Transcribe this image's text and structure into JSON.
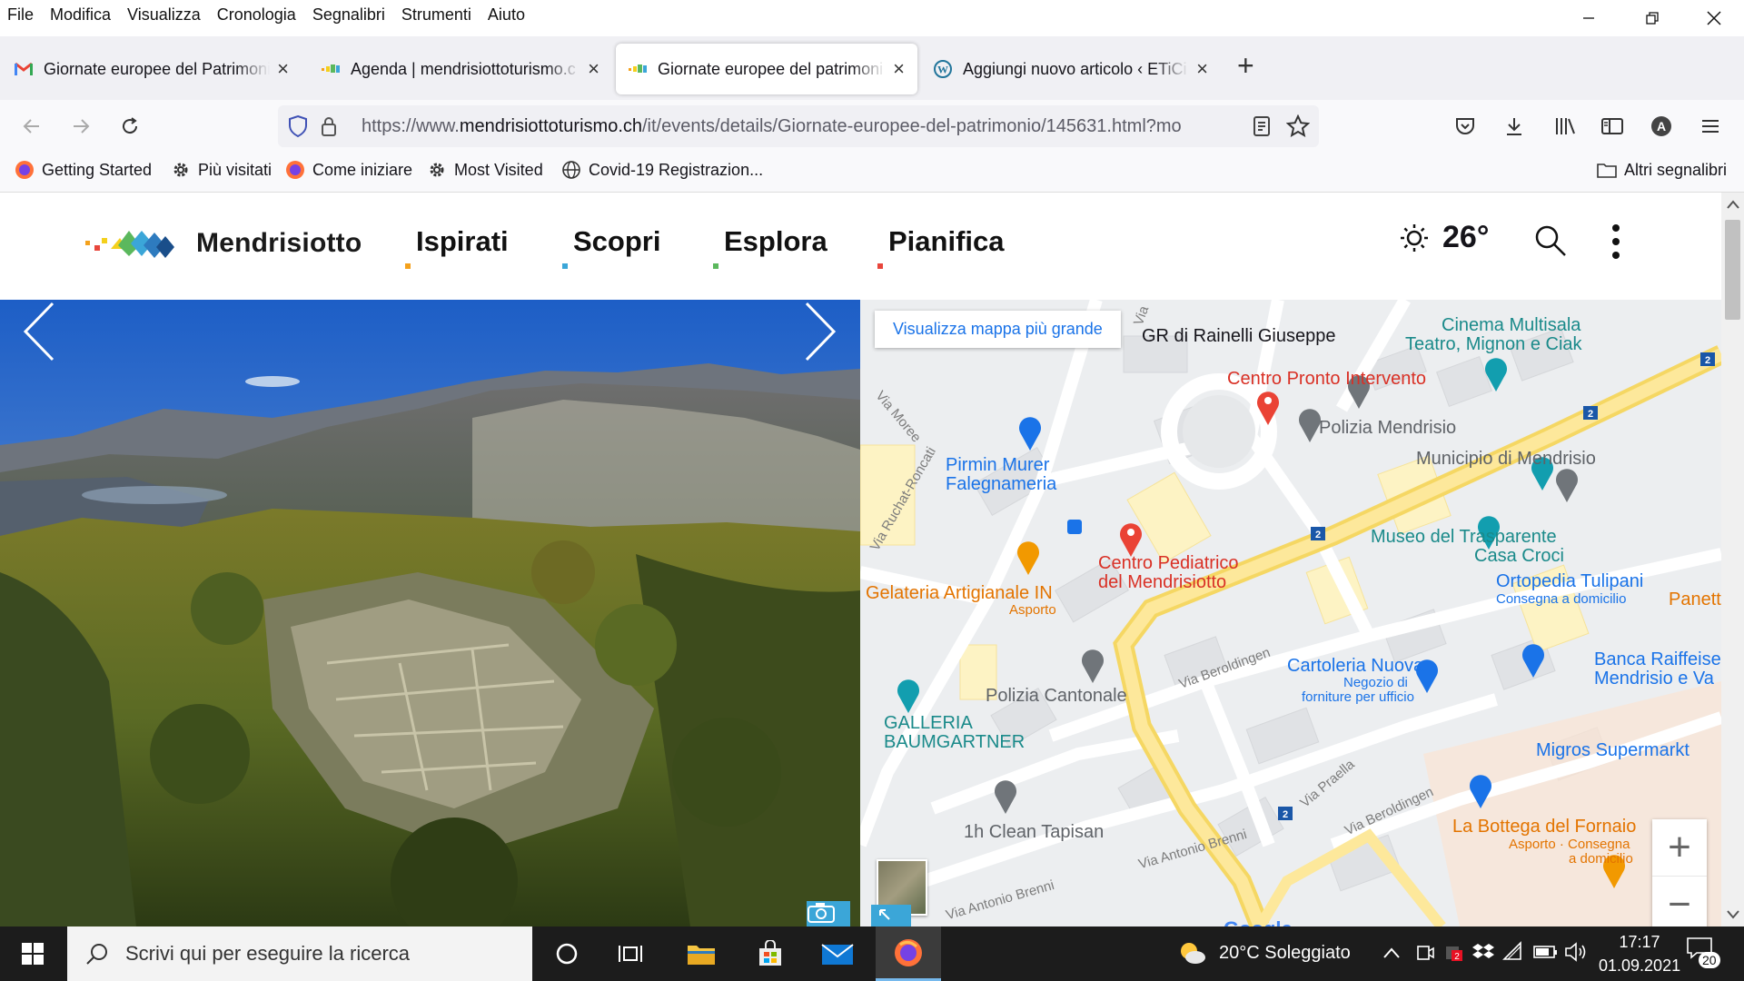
{
  "menubar": [
    "File",
    "Modifica",
    "Visualizza",
    "Cronologia",
    "Segnalibri",
    "Strumenti",
    "Aiuto"
  ],
  "tabs": [
    {
      "title": "Giornate europee del Patrimoni",
      "icon": "gmail-icon"
    },
    {
      "title": "Agenda | mendrisiottoturismo.c",
      "icon": "mendrisiotto-icon"
    },
    {
      "title": "Giornate europee del patrimoni",
      "icon": "mendrisiotto-icon"
    },
    {
      "title": "Aggiungi nuovo articolo ‹ ETiCi",
      "icon": "wordpress-icon"
    }
  ],
  "url": {
    "prefix": "https://www.",
    "domain": "mendrisiottoturismo.ch",
    "path": "/it/events/details/Giornate-europee-del-patrimonio/145631.html?mo"
  },
  "bookmarks": {
    "items": [
      "Getting Started",
      "Più visitati",
      "Come iniziare",
      "Most Visited",
      "Covid-19 Registrazion..."
    ],
    "other": "Altri segnalibri"
  },
  "site": {
    "logo": "Mendrisiotto",
    "nav": [
      {
        "label": "Ispirati",
        "color": "#f4a11c"
      },
      {
        "label": "Scopri",
        "color": "#3ba6d8"
      },
      {
        "label": "Esplora",
        "color": "#5bb85d"
      },
      {
        "label": "Pianifica",
        "color": "#e8463c"
      }
    ],
    "temperature": "26°"
  },
  "map": {
    "view_larger": "Visualizza mappa più grande",
    "labels": [
      {
        "t": "GR di Rainelli Giuseppe",
        "c": "c-grey"
      },
      {
        "t": "Cinema Multisala",
        "c": "c-teal"
      },
      {
        "t": "Teatro, Mignon e Ciak",
        "c": "c-teal"
      },
      {
        "t": "Centro Pronto Intervento",
        "c": "c-red"
      },
      {
        "t": "Polizia Mendrisio",
        "c": "c-grey"
      },
      {
        "t": "Municipio di Mendrisio",
        "c": "c-grey"
      },
      {
        "t": "Pirmin Murer",
        "c": "c-blue"
      },
      {
        "t": "Falegnameria",
        "c": "c-blue"
      },
      {
        "t": "Museo del Trasparente",
        "c": "c-teal"
      },
      {
        "t": "Casa Croci",
        "c": "c-teal"
      },
      {
        "t": "Centro Pediatrico",
        "c": "c-red"
      },
      {
        "t": "del Mendrisiotto",
        "c": "c-red"
      },
      {
        "t": "Ortopedia Tulipani",
        "c": "c-blue"
      },
      {
        "t": "Consegna a domicilio",
        "c": "c-blue"
      },
      {
        "t": "Gelateria Artigianale IN",
        "c": "c-orange"
      },
      {
        "t": "Asporto",
        "c": "c-orange"
      },
      {
        "t": "Panett",
        "c": "c-orange"
      },
      {
        "t": "Cartoleria Nuova",
        "c": "c-blue"
      },
      {
        "t": "Negozio di",
        "c": "c-blue"
      },
      {
        "t": "forniture per ufficio",
        "c": "c-blue"
      },
      {
        "t": "Banca Raiffeise",
        "c": "c-blue"
      },
      {
        "t": "Mendrisio e Va",
        "c": "c-blue"
      },
      {
        "t": "Polizia Cantonale",
        "c": "c-grey"
      },
      {
        "t": "GALLERIA",
        "c": "c-teal"
      },
      {
        "t": "BAUMGARTNER",
        "c": "c-teal"
      },
      {
        "t": "Migros Supermarkt",
        "c": "c-blue"
      },
      {
        "t": "1h Clean Tapisan",
        "c": "c-grey"
      },
      {
        "t": "La Bottega del Fornaio",
        "c": "c-orange"
      },
      {
        "t": "Asporto · Consegna",
        "c": "c-orange"
      },
      {
        "t": "a domicilio",
        "c": "c-orange"
      }
    ],
    "roads": [
      "Via Moree",
      "Via Ruchat-Roncati",
      "Via Beroldingen",
      "Via Praella",
      "Via Beroldingen",
      "Via Antonio Brenni",
      "Via Antonio Brenni",
      "Via"
    ],
    "google": "Google"
  },
  "taskbar": {
    "search_placeholder": "Scrivi qui per eseguire la ricerca",
    "weather": "20°C  Soleggiato",
    "time": "17:17",
    "date": "01.09.2021",
    "notifications": "20"
  }
}
